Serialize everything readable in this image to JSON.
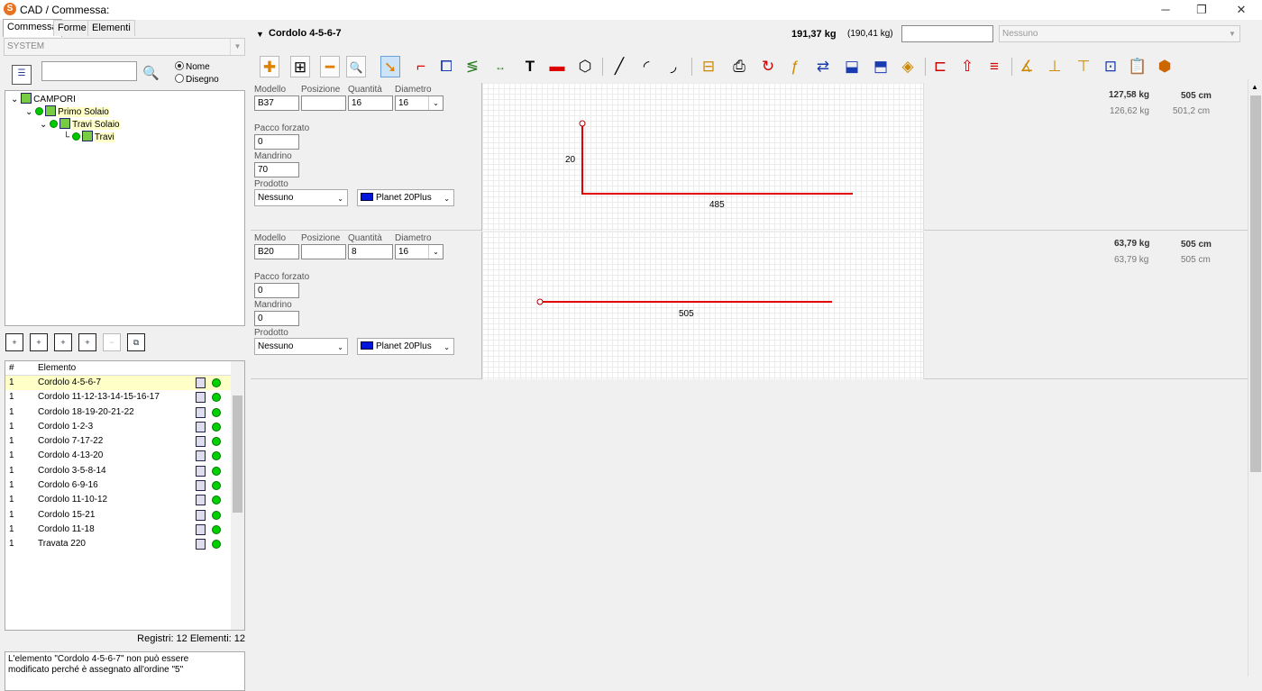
{
  "window": {
    "title": "CAD / Commessa:",
    "logo": "S"
  },
  "left": {
    "tabs": [
      "Commessa",
      "Forme",
      "Elementi"
    ],
    "system_value": "SYSTEM",
    "radio": {
      "nome": "Nome",
      "disegno": "Disegno"
    },
    "tree": [
      "CAMPORI",
      "Primo Solaio",
      "Travi Solaio",
      "Travi"
    ],
    "columns": {
      "num": "#",
      "elemento": "Elemento"
    },
    "elements": [
      {
        "n": "1",
        "name": "Cordolo 4-5-6-7"
      },
      {
        "n": "1",
        "name": "Cordolo 11-12-13-14-15-16-17"
      },
      {
        "n": "1",
        "name": "Cordolo 18-19-20-21-22"
      },
      {
        "n": "1",
        "name": "Cordolo 1-2-3"
      },
      {
        "n": "1",
        "name": "Cordolo 7-17-22"
      },
      {
        "n": "1",
        "name": "Cordolo 4-13-20"
      },
      {
        "n": "1",
        "name": "Cordolo 3-5-8-14"
      },
      {
        "n": "1",
        "name": "Cordolo 6-9-16"
      },
      {
        "n": "1",
        "name": "Cordolo 11-10-12"
      },
      {
        "n": "1",
        "name": "Cordolo 15-21"
      },
      {
        "n": "1",
        "name": "Cordolo 11-18"
      },
      {
        "n": "1",
        "name": "Travata 220"
      }
    ],
    "counts": "Registri: 12  Elementi: 12",
    "message": "L'elemento \"Cordolo 4-5-6-7\" non può essere modificato perché è assegnato all'ordine \"5\""
  },
  "header": {
    "title": "Cordolo 4-5-6-7",
    "weight": "191,37 kg",
    "weight_alt": "(190,41 kg)",
    "combo": "Nessuno"
  },
  "labels": {
    "modello": "Modello",
    "posizione": "Posizione",
    "quantita": "Quantità",
    "diametro": "Diametro",
    "pacco": "Pacco forzato",
    "mandrino": "Mandrino",
    "prodotto": "Prodotto"
  },
  "rows": [
    {
      "modello": "B37",
      "posizione": "",
      "quantita": "16",
      "diametro": "16",
      "pacco": "0",
      "mandrino": "70",
      "prodotto": "Nessuno",
      "materiale": "Planet 20Plus",
      "w1": "127,58 kg",
      "l1": "505 cm",
      "w2": "126,62 kg",
      "l2": "501,2 cm",
      "dim_a": "20",
      "dim_b": "485"
    },
    {
      "modello": "B20",
      "posizione": "",
      "quantita": "8",
      "diametro": "16",
      "pacco": "0",
      "mandrino": "0",
      "prodotto": "Nessuno",
      "materiale": "Planet 20Plus",
      "w1": "63,79 kg",
      "l1": "505 cm",
      "w2": "63,79 kg",
      "l2": "505 cm",
      "dim_b": "505"
    }
  ],
  "colors": {
    "bar": "#e00000",
    "material": "#0014dc",
    "ok": "#00d000"
  }
}
